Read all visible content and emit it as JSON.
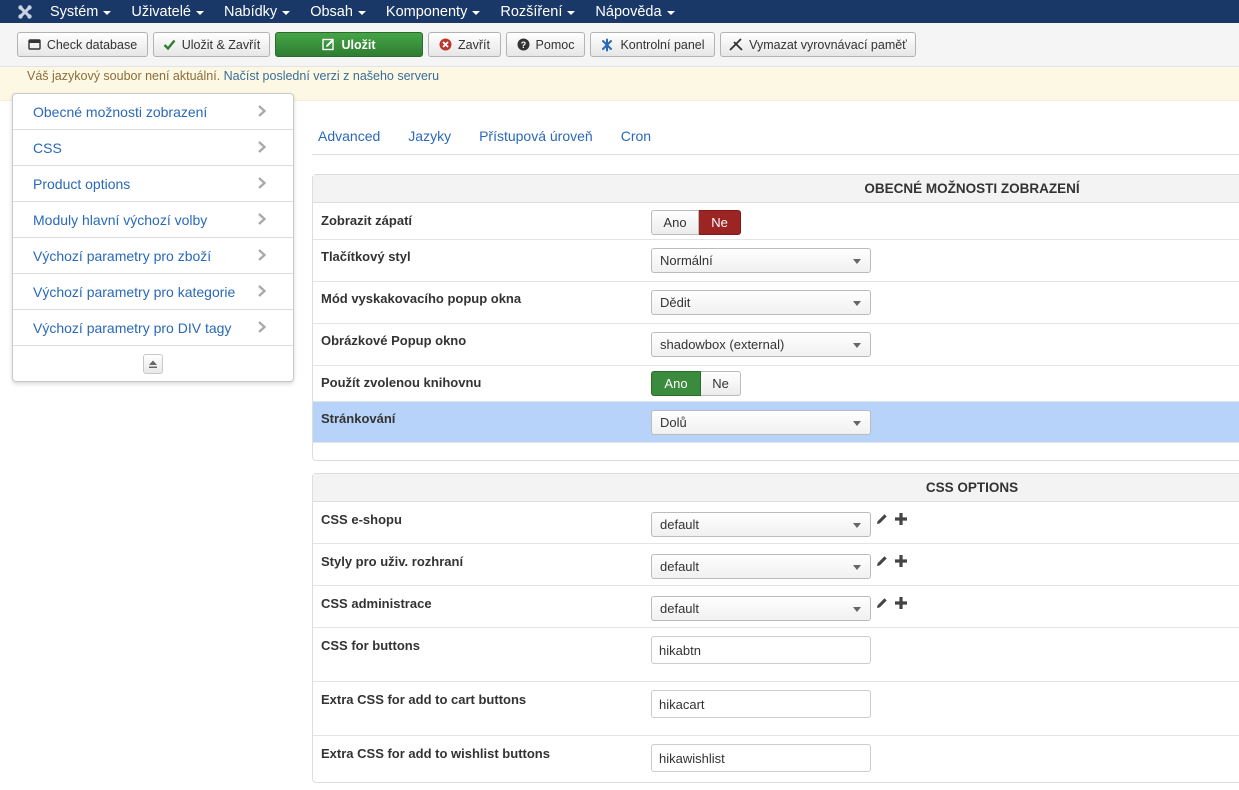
{
  "nav": {
    "items": [
      "Systém",
      "Uživatelé",
      "Nabídky",
      "Obsah",
      "Komponenty",
      "Rozšíření",
      "Nápověda"
    ]
  },
  "toolbar": {
    "check_database": "Check database",
    "save_close": "Uložit & Zavřít",
    "save": "Uložit",
    "close": "Zavřít",
    "help": "Pomoc",
    "control_panel": "Kontrolní panel",
    "clear_cache": "Vymazat vyrovnávací paměť"
  },
  "message": {
    "text": "Váš jazykový soubor není aktuální.",
    "link": "Načíst poslední verzi z našeho serveru"
  },
  "sidebar": {
    "items": [
      "Obecné možnosti zobrazení",
      "CSS",
      "Product options",
      "Moduly hlavní výchozí volby",
      "Výchozí parametry pro zboží",
      "Výchozí parametry pro kategorie",
      "Výchozí parametry pro DIV tagy"
    ]
  },
  "tabs": [
    "Advanced",
    "Jazyky",
    "Přístupová úroveň",
    "Cron"
  ],
  "general": {
    "title": "OBECNÉ MOŽNOSTI ZOBRAZENÍ",
    "footer_label": "Zobrazit zápatí",
    "footer_yes": "Ano",
    "footer_no": "Ne",
    "button_style_label": "Tlačítkový styl",
    "button_style_value": "Normální",
    "popup_mode_label": "Mód vyskakovacího popup okna",
    "popup_mode_value": "Dědit",
    "image_popup_label": "Obrázkové Popup okno",
    "image_popup_value": "shadowbox (external)",
    "library_label": "Použít zvolenou knihovnu",
    "library_yes": "Ano",
    "library_no": "Ne",
    "pagination_label": "Stránkování",
    "pagination_value": "Dolů"
  },
  "css": {
    "title": "CSS OPTIONS",
    "shop_label": "CSS e-shopu",
    "shop_value": "default",
    "ui_label": "Styly pro uživ. rozhraní",
    "ui_value": "default",
    "admin_label": "CSS administrace",
    "admin_value": "default",
    "buttons_label": "CSS for buttons",
    "buttons_value": "hikabtn",
    "cart_label": "Extra CSS for add to cart buttons",
    "cart_value": "hikacart",
    "wishlist_label": "Extra CSS for add to wishlist buttons",
    "wishlist_value": "hikawishlist"
  }
}
